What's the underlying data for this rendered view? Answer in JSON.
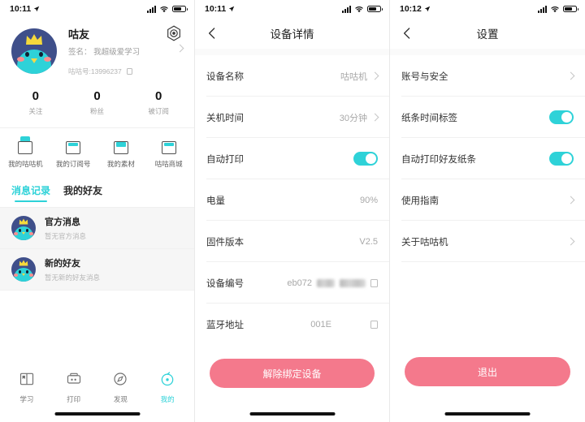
{
  "colors": {
    "accent_teal": "#2ed2d8",
    "button_pink": "#f4798c",
    "text_dark": "#222222",
    "text_muted": "#a8a8a8"
  },
  "screen_profile": {
    "statusbar": {
      "time": "10:11",
      "signal_icon": "cellular-signal-icon",
      "wifi_icon": "wifi-icon",
      "battery_icon": "battery-icon"
    },
    "gear_icon_name": "settings-gear-icon",
    "profile": {
      "avatar_name": "user-avatar",
      "name": "咕友",
      "signature": "签名： 我超级爱学习",
      "id_label": "咕咕号:13996237",
      "copy_icon": "copy-icon",
      "arrow_icon": "chevron-right-icon"
    },
    "stats": [
      {
        "num": "0",
        "label": "关注"
      },
      {
        "num": "0",
        "label": "粉丝"
      },
      {
        "num": "0",
        "label": "被订阅"
      }
    ],
    "quick_entries": [
      {
        "label": "我的咕咕机",
        "icon": "printer-icon"
      },
      {
        "label": "我的订阅号",
        "icon": "subscription-icon"
      },
      {
        "label": "我的素材",
        "icon": "material-icon"
      },
      {
        "label": "咕咕商城",
        "icon": "shop-icon"
      }
    ],
    "tabs": [
      {
        "label": "消息记录",
        "active": true
      },
      {
        "label": "我的好友",
        "active": false
      }
    ],
    "messages": [
      {
        "title": "官方消息",
        "subtitle": "暂无官方消息"
      },
      {
        "title": "新的好友",
        "subtitle": "暂无新的好友消息"
      }
    ],
    "bottom_nav": [
      {
        "label": "学习",
        "icon": "book-icon",
        "active": false
      },
      {
        "label": "打印",
        "icon": "printer-icon",
        "active": false
      },
      {
        "label": "发现",
        "icon": "compass-icon",
        "active": false
      },
      {
        "label": "我的",
        "icon": "profile-icon",
        "active": true
      }
    ]
  },
  "screen_device": {
    "statusbar": {
      "time": "10:11"
    },
    "navbar": {
      "title": "设备详情",
      "back_icon": "chevron-left-icon"
    },
    "rows": [
      {
        "label": "设备名称",
        "value": "咕咕机",
        "type": "link"
      },
      {
        "label": "关机时间",
        "value": "30分钟",
        "type": "link"
      },
      {
        "label": "自动打印",
        "value": "",
        "type": "toggle",
        "toggle_on": true
      },
      {
        "label": "电量",
        "value": "90%",
        "type": "value"
      },
      {
        "label": "固件版本",
        "value": "V2.5",
        "type": "value"
      },
      {
        "label": "设备编号",
        "value": "eb072",
        "type": "copy-masked"
      },
      {
        "label": "蓝牙地址",
        "value": "001E",
        "type": "copy"
      }
    ],
    "action_button": "解除绑定设备"
  },
  "screen_settings": {
    "statusbar": {
      "time": "10:12"
    },
    "navbar": {
      "title": "设置",
      "back_icon": "chevron-left-icon"
    },
    "rows": [
      {
        "label": "账号与安全",
        "type": "link"
      },
      {
        "label": "纸条时间标签",
        "type": "toggle",
        "toggle_on": true
      },
      {
        "label": "自动打印好友纸条",
        "type": "toggle",
        "toggle_on": true
      },
      {
        "label": "使用指南",
        "type": "link"
      },
      {
        "label": "关于咕咕机",
        "type": "link"
      }
    ],
    "action_button": "退出"
  }
}
